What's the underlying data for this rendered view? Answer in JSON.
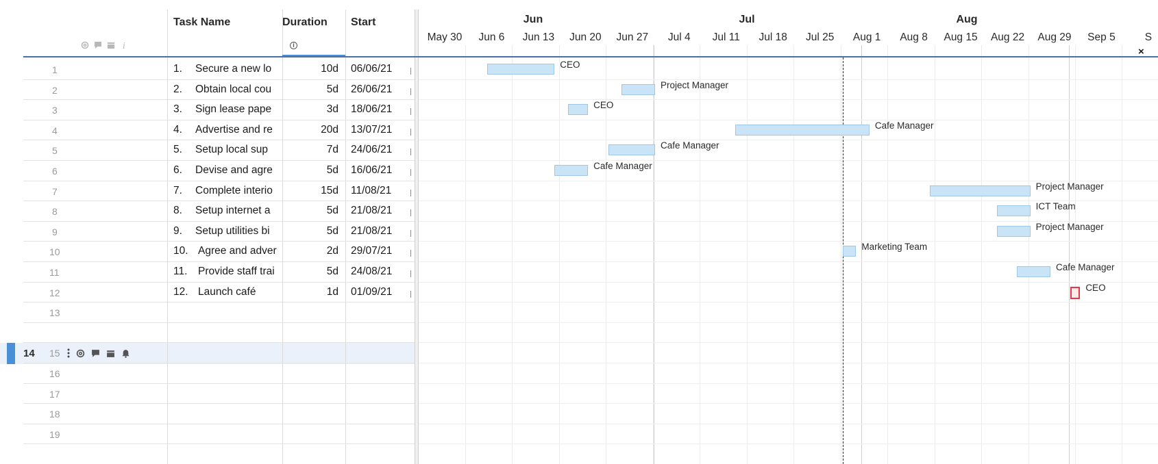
{
  "columns": {
    "task_name": "Task Name",
    "duration": "Duration",
    "start": "Start",
    "duration_info": "i"
  },
  "header_icons": [
    "attachment-icon",
    "comment-icon",
    "proof-icon",
    "info-icon"
  ],
  "rows": [
    {
      "num": "1",
      "task_num": "1.",
      "task_name": "Secure a new lo",
      "duration": "10d",
      "start": "06/06/21"
    },
    {
      "num": "2",
      "task_num": "2.",
      "task_name": "Obtain local cou",
      "duration": "5d",
      "start": "26/06/21"
    },
    {
      "num": "3",
      "task_num": "3.",
      "task_name": "Sign lease pape",
      "duration": "3d",
      "start": "18/06/21"
    },
    {
      "num": "4",
      "task_num": "4.",
      "task_name": "Advertise and re",
      "duration": "20d",
      "start": "13/07/21"
    },
    {
      "num": "5",
      "task_num": "5.",
      "task_name": "Setup local sup",
      "duration": "7d",
      "start": "24/06/21"
    },
    {
      "num": "6",
      "task_num": "6.",
      "task_name": "Devise and agre",
      "duration": "5d",
      "start": "16/06/21"
    },
    {
      "num": "7",
      "task_num": "7.",
      "task_name": "Complete interio",
      "duration": "15d",
      "start": "11/08/21"
    },
    {
      "num": "8",
      "task_num": "8.",
      "task_name": "Setup internet a",
      "duration": "5d",
      "start": "21/08/21"
    },
    {
      "num": "9",
      "task_num": "9.",
      "task_name": "Setup utilities bi",
      "duration": "5d",
      "start": "21/08/21"
    },
    {
      "num": "10",
      "task_num": "10.",
      "task_name": "Agree and adver",
      "duration": "2d",
      "start": "29/07/21"
    },
    {
      "num": "11",
      "task_num": "11.",
      "task_name": "Provide staff trai",
      "duration": "5d",
      "start": "24/08/21"
    },
    {
      "num": "12",
      "task_num": "12.",
      "task_name": "Launch café",
      "duration": "1d",
      "start": "01/09/21"
    },
    {
      "num": "13",
      "task_num": "",
      "task_name": "",
      "duration": "",
      "start": ""
    },
    {
      "num": "14",
      "task_num": "",
      "task_name": "",
      "duration": "",
      "start": ""
    },
    {
      "num": "15",
      "task_num": "",
      "task_name": "",
      "duration": "",
      "start": ""
    },
    {
      "num": "16",
      "task_num": "",
      "task_name": "",
      "duration": "",
      "start": ""
    },
    {
      "num": "17",
      "task_num": "",
      "task_name": "",
      "duration": "",
      "start": ""
    },
    {
      "num": "18",
      "task_num": "",
      "task_name": "",
      "duration": "",
      "start": ""
    },
    {
      "num": "19",
      "task_num": "",
      "task_name": "",
      "duration": "",
      "start": ""
    }
  ],
  "active_row": {
    "num": "14",
    "icons": [
      "more-vertical-icon",
      "attachment-icon",
      "comment-icon",
      "proof-icon",
      "bell-icon"
    ]
  },
  "timeline": {
    "months": [
      "Jun",
      "Jul",
      "Aug"
    ],
    "weeks": [
      "May 30",
      "Jun 6",
      "Jun 13",
      "Jun 20",
      "Jun 27",
      "Jul 4",
      "Jul 11",
      "Jul 18",
      "Jul 25",
      "Aug 1",
      "Aug 8",
      "Aug 15",
      "Aug 22",
      "Aug 29",
      "Sep 5",
      "S"
    ],
    "today": "29/07/21"
  },
  "gantt_bars": [
    {
      "row": 1,
      "start": "2021-06-06",
      "end": "2021-06-16",
      "assignee": "CEO"
    },
    {
      "row": 2,
      "start": "2021-06-26",
      "end": "2021-07-01",
      "assignee": "Project Manager"
    },
    {
      "row": 3,
      "start": "2021-06-18",
      "end": "2021-06-21",
      "assignee": "CEO"
    },
    {
      "row": 4,
      "start": "2021-07-13",
      "end": "2021-08-02",
      "assignee": "Cafe Manager"
    },
    {
      "row": 5,
      "start": "2021-06-24",
      "end": "2021-07-01",
      "assignee": "Cafe Manager"
    },
    {
      "row": 6,
      "start": "2021-06-16",
      "end": "2021-06-21",
      "assignee": "Cafe Manager"
    },
    {
      "row": 7,
      "start": "2021-08-11",
      "end": "2021-08-26",
      "assignee": "Project Manager"
    },
    {
      "row": 8,
      "start": "2021-08-21",
      "end": "2021-08-26",
      "assignee": "ICT Team"
    },
    {
      "row": 9,
      "start": "2021-08-21",
      "end": "2021-08-26",
      "assignee": "Project Manager"
    },
    {
      "row": 10,
      "start": "2021-07-29",
      "end": "2021-07-31",
      "assignee": "Marketing Team"
    },
    {
      "row": 11,
      "start": "2021-08-24",
      "end": "2021-08-29",
      "assignee": "Cafe Manager"
    },
    {
      "row": 12,
      "start": "2021-09-01",
      "end": "2021-09-02",
      "assignee": "CEO",
      "milestone": true
    }
  ],
  "close_label": "×",
  "colors": {
    "bar_fill": "#c9e3f7",
    "bar_border": "#9fc6e6",
    "milestone_border": "#e03a4a",
    "accent": "#4a90d9"
  }
}
